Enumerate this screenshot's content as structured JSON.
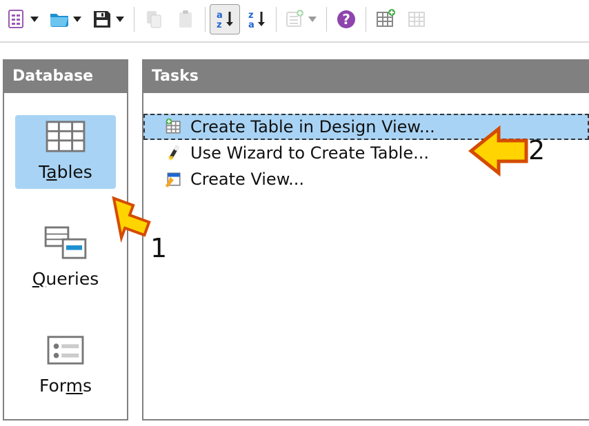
{
  "sidebar": {
    "title": "Database",
    "items": [
      {
        "label_pre": "T",
        "label_ak": "a",
        "label_post": "bles",
        "selected": true
      },
      {
        "label_pre": "",
        "label_ak": "Q",
        "label_post": "ueries",
        "selected": false
      },
      {
        "label_pre": "For",
        "label_ak": "m",
        "label_post": "s",
        "selected": false
      }
    ]
  },
  "tasks": {
    "title": "Tasks",
    "items": [
      {
        "label": "Create Table in Design View...",
        "selected": true
      },
      {
        "label": "Use Wizard to Create Table...",
        "selected": false
      },
      {
        "label": "Create View...",
        "selected": false
      }
    ]
  },
  "callouts": {
    "one": "1",
    "two": "2"
  }
}
